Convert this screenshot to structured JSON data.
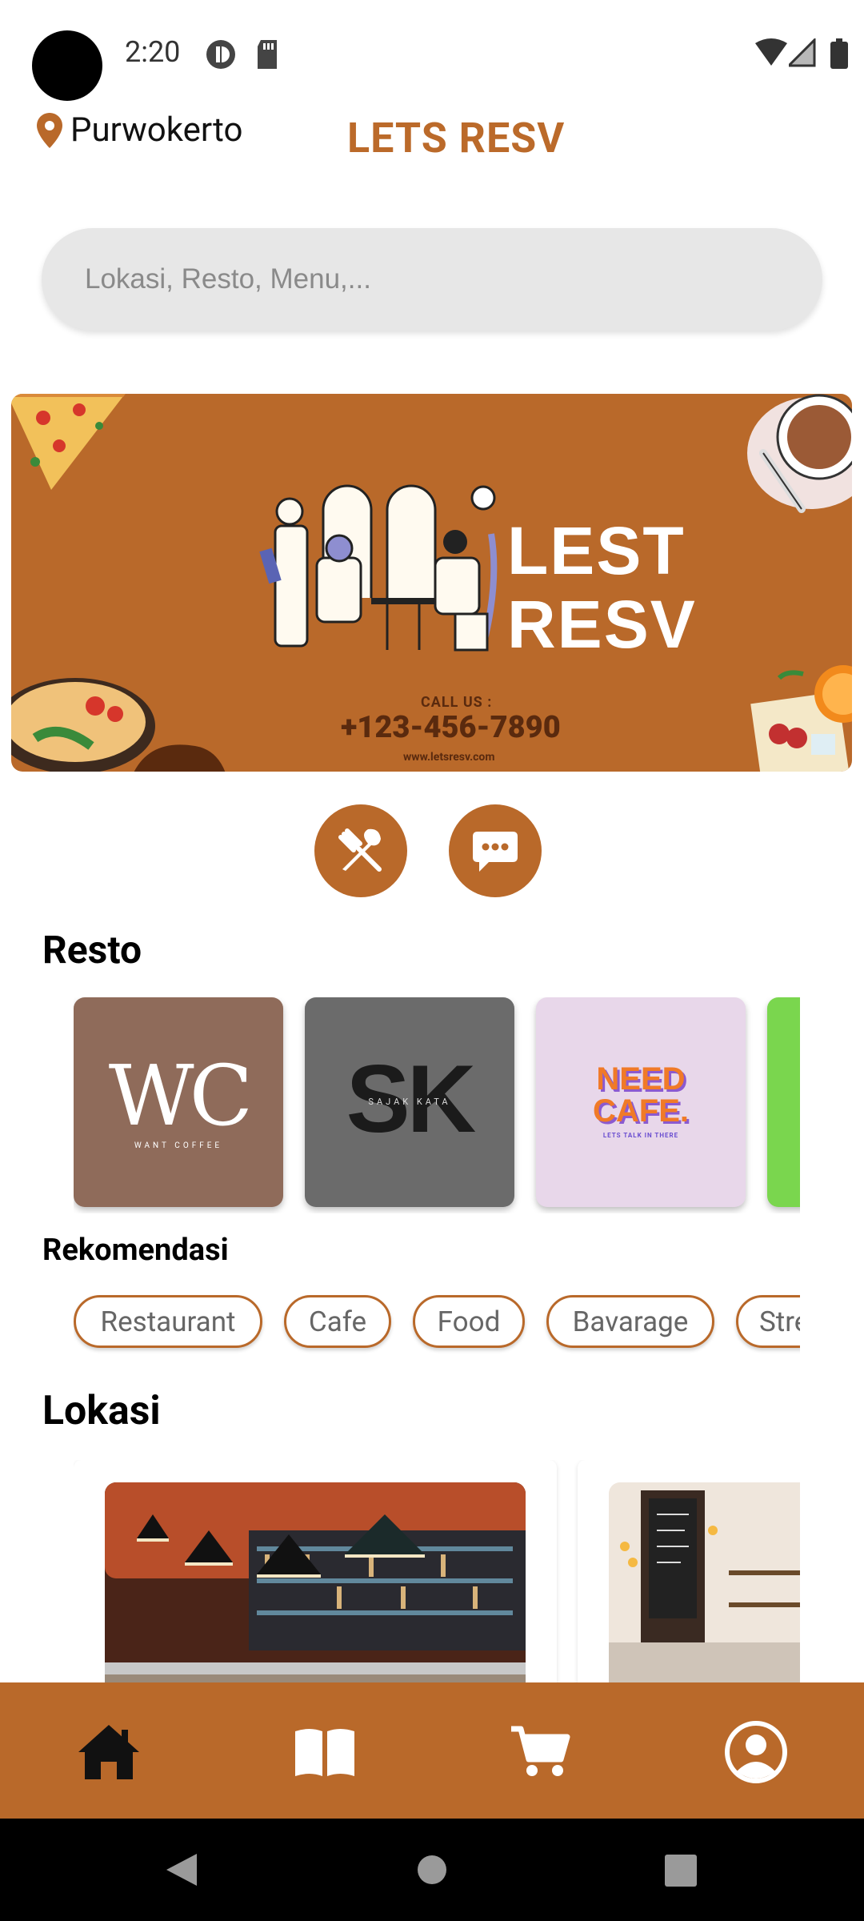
{
  "status_bar": {
    "time": "2:20",
    "icons": [
      "camera-cutout",
      "vpn-icon",
      "sd-card-icon",
      "wifi-icon",
      "signal-icon",
      "battery-icon"
    ]
  },
  "header": {
    "location_icon": "map-pin-icon",
    "location": "Purwokerto",
    "brand": "LETS RESV"
  },
  "search": {
    "placeholder": "Lokasi, Resto, Menu,..."
  },
  "banner": {
    "title_line1": "LEST",
    "title_line2": "RESV",
    "call_us": "CALL US :",
    "phone": "+123-456-7890",
    "website": "www.letsresv.com"
  },
  "actions": [
    {
      "name": "restaurant-action",
      "icon": "fork-knife-icon"
    },
    {
      "name": "chat-action",
      "icon": "chat-bubble-icon"
    }
  ],
  "resto": {
    "title": "Resto",
    "cards": [
      {
        "logo_main": "WC",
        "logo_sub": "WANT COFFEE",
        "bg": "#8f6b5a"
      },
      {
        "logo_main": "SK",
        "logo_sub": "SAJAK KATA",
        "bg": "#6b6b6b"
      },
      {
        "logo_main": "NEED CAFE.",
        "logo_sub": "LETS TALK IN THERE",
        "bg": "#e8d7ea"
      },
      {
        "logo_main": "",
        "logo_sub": "",
        "bg": "#7ad64e"
      }
    ]
  },
  "rekomendasi": {
    "title": "Rekomendasi",
    "chips": [
      "Restaurant",
      "Cafe",
      "Food",
      "Bavarage",
      "Street Food"
    ]
  },
  "lokasi": {
    "title": "Lokasi"
  },
  "bottom_nav": [
    {
      "name": "home",
      "icon": "home-icon",
      "active": true
    },
    {
      "name": "menu",
      "icon": "book-icon",
      "active": false
    },
    {
      "name": "cart",
      "icon": "cart-icon",
      "active": false
    },
    {
      "name": "profile",
      "icon": "profile-icon",
      "active": false
    }
  ],
  "colors": {
    "accent": "#b9692a",
    "brand_text": "#bb6a2a"
  }
}
